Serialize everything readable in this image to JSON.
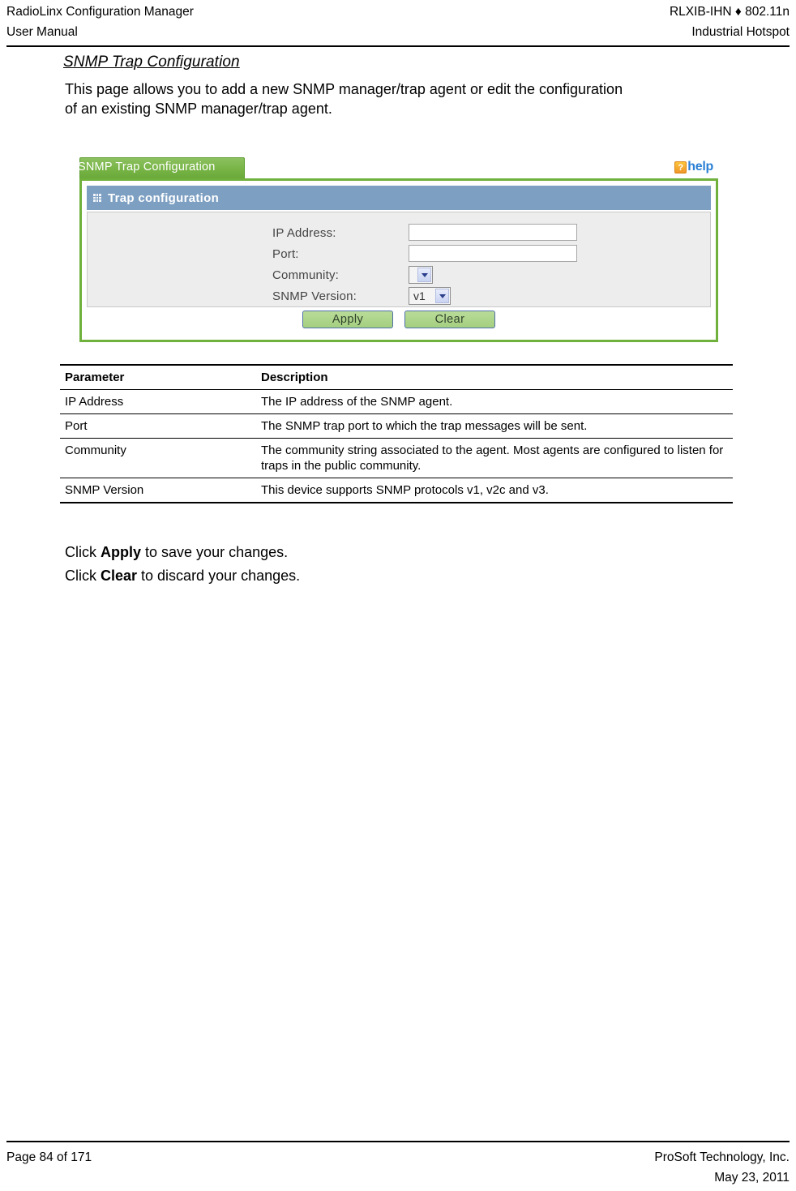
{
  "header": {
    "left_line1": "RadioLinx Configuration Manager",
    "left_line2": "User Manual",
    "right_line1": "RLXIB-IHN ♦ 802.11n",
    "right_line2": "Industrial Hotspot"
  },
  "section": {
    "title": "SNMP Trap Configuration",
    "intro": "This page allows you to add a new SNMP manager/trap agent or edit the configuration of an existing SNMP manager/trap agent."
  },
  "screenshot": {
    "tab_label": "SNMP Trap Configuration",
    "help_icon": "question-mark-icon",
    "help_label": "help",
    "panel_icon": "grid-icon",
    "panel_title": "Trap configuration",
    "fields": [
      {
        "label": "IP Address:",
        "type": "text",
        "value": ""
      },
      {
        "label": "Port:",
        "type": "text",
        "value": ""
      },
      {
        "label": "Community:",
        "type": "select",
        "value": ""
      },
      {
        "label": "SNMP Version:",
        "type": "select",
        "value": "v1"
      }
    ],
    "buttons": {
      "apply": "Apply",
      "clear": "Clear"
    },
    "colors": {
      "tab_green": "#7ab648",
      "panel_border_green": "#6fb13c",
      "section_blue": "#7d9fc2",
      "form_gray": "#ededed",
      "button_green": "#a4cf80",
      "help_blue": "#2a7fd4",
      "help_icon_orange": "#f0962a"
    }
  },
  "table": {
    "columns": [
      "Parameter",
      "Description"
    ],
    "rows": [
      {
        "parameter": "IP Address",
        "description": "The IP address of the SNMP agent."
      },
      {
        "parameter": "Port",
        "description": "The SNMP trap port to which the trap messages will be sent."
      },
      {
        "parameter": "Community",
        "description": "The community string associated to the agent. Most agents are configured to listen for traps in the public community."
      },
      {
        "parameter": "SNMP Version",
        "description": "This device supports SNMP protocols v1, v2c and v3."
      }
    ]
  },
  "closing": {
    "line1_prefix": "Click ",
    "line1_bold": "Apply",
    "line1_suffix": " to save your changes.",
    "line2_prefix": "Click ",
    "line2_bold": "Clear",
    "line2_suffix": " to discard your changes."
  },
  "footer": {
    "left": "Page 84 of 171",
    "right_line1": "ProSoft Technology, Inc.",
    "right_line2": "May 23, 2011"
  }
}
